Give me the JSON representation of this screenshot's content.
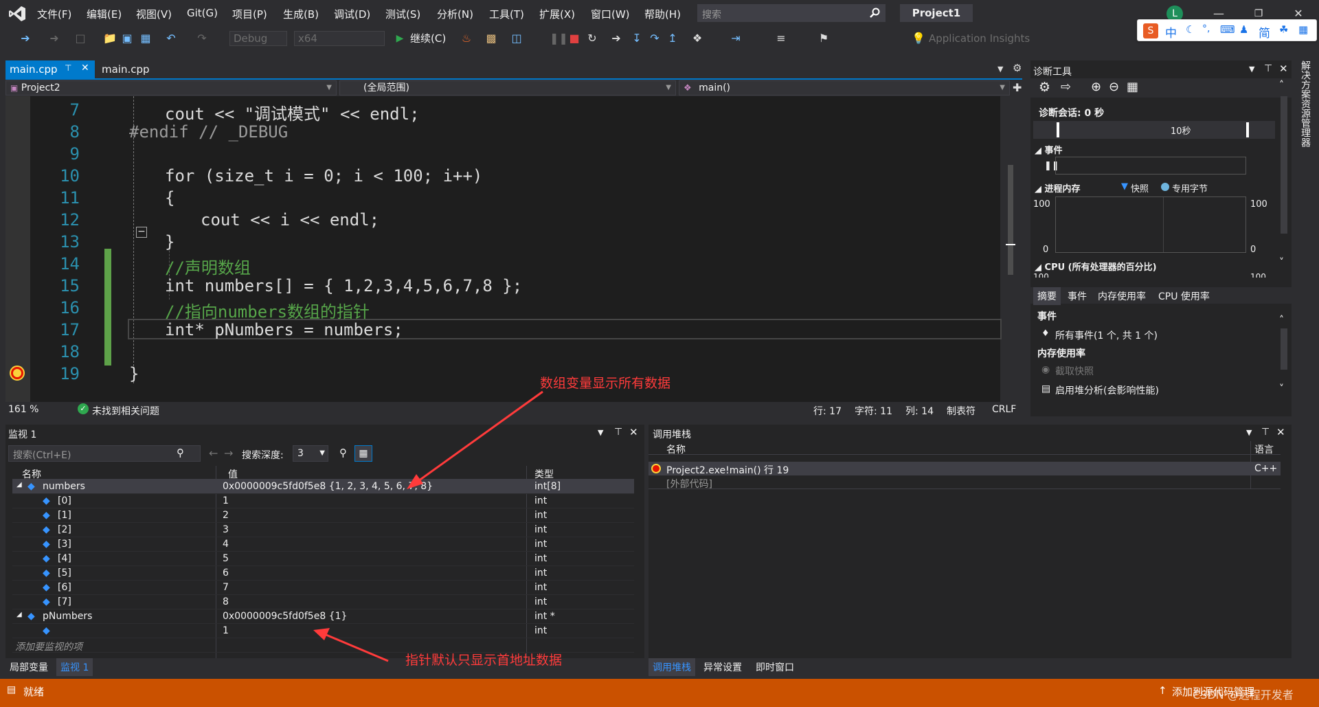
{
  "menu": [
    "文件(F)",
    "编辑(E)",
    "视图(V)",
    "Git(G)",
    "项目(P)",
    "生成(B)",
    "调试(D)",
    "测试(S)",
    "分析(N)",
    "工具(T)",
    "扩展(X)",
    "窗口(W)",
    "帮助(H)"
  ],
  "search": {
    "placeholder": "搜索"
  },
  "project_title": "Project1",
  "avatar_letter": "L",
  "toolbar": {
    "config": "Debug",
    "platform": "x64",
    "continue_label": "继续(C)",
    "insights": "Application Insights"
  },
  "ime": {
    "mode": "中",
    "simplified": "简"
  },
  "tabs": [
    {
      "label": "main.cpp",
      "active": true
    },
    {
      "label": "main.cpp",
      "active": false
    }
  ],
  "nav": {
    "project": "Project2",
    "scope": "(全局范围)",
    "function": "main()"
  },
  "code_lines": [
    {
      "num": "7",
      "text": "cout << \"调试模式\" << endl;"
    },
    {
      "num": "8",
      "text": "#endif // _DEBUG"
    },
    {
      "num": "9",
      "text": ""
    },
    {
      "num": "10",
      "text": "for (size_t i = 0; i < 100; i++)"
    },
    {
      "num": "11",
      "text": "{"
    },
    {
      "num": "12",
      "text": "cout << i << endl;"
    },
    {
      "num": "13",
      "text": "}"
    },
    {
      "num": "14",
      "text": "//声明数组"
    },
    {
      "num": "15",
      "text": "int numbers[] = { 1,2,3,4,5,6,7,8 };"
    },
    {
      "num": "16",
      "text": "//指向numbers数组的指针"
    },
    {
      "num": "17",
      "text": "int* pNumbers = numbers;"
    },
    {
      "num": "18",
      "text": ""
    },
    {
      "num": "19",
      "text": "}"
    }
  ],
  "editor_status": {
    "zoom": "161 %",
    "issues": "未找到相关问题",
    "line": "行: 17",
    "char": "字符: 11",
    "col": "列: 14",
    "tab": "制表符",
    "eol": "CRLF"
  },
  "diag": {
    "title": "诊断工具",
    "session": "诊断会话: 0 秒",
    "timeline_label": "10秒",
    "events_header": "事件",
    "memory_header": "进程内存",
    "legend_snapshot": "快照",
    "legend_private": "专用字节",
    "mem_max": "100",
    "mem_min": "0",
    "cpu_header": "CPU (所有处理器的百分比)",
    "cpu_max": "100",
    "tabs": [
      "摘要",
      "事件",
      "内存使用率",
      "CPU 使用率"
    ],
    "events_section": "事件",
    "all_events": "所有事件(1 个, 共 1 个)",
    "mem_section": "内存使用率",
    "take_snapshot": "截取快照",
    "heap_analysis": "启用堆分析(会影响性能)"
  },
  "side_tab": "解决方案资源管理器",
  "watch": {
    "title": "监视 1",
    "search_placeholder": "搜索(Ctrl+E)",
    "depth_label": "搜索深度:",
    "depth_value": "3",
    "columns": [
      "名称",
      "值",
      "类型"
    ],
    "rows": [
      {
        "name": "numbers",
        "value": "0x0000009c5fd0f5e8 {1, 2, 3, 4, 5, 6, 7, 8}",
        "type": "int[8]"
      },
      {
        "name": "[0]",
        "value": "1",
        "type": "int"
      },
      {
        "name": "[1]",
        "value": "2",
        "type": "int"
      },
      {
        "name": "[2]",
        "value": "3",
        "type": "int"
      },
      {
        "name": "[3]",
        "value": "4",
        "type": "int"
      },
      {
        "name": "[4]",
        "value": "5",
        "type": "int"
      },
      {
        "name": "[5]",
        "value": "6",
        "type": "int"
      },
      {
        "name": "[6]",
        "value": "7",
        "type": "int"
      },
      {
        "name": "[7]",
        "value": "8",
        "type": "int"
      },
      {
        "name": "pNumbers",
        "value": "0x0000009c5fd0f5e8 {1}",
        "type": "int *"
      },
      {
        "name": "",
        "value": "1",
        "type": "int"
      }
    ],
    "add_item": "添加要监视的项",
    "bottom_tabs": [
      "局部变量",
      "监视 1"
    ]
  },
  "callstack": {
    "title": "调用堆栈",
    "columns": [
      "名称",
      "语言"
    ],
    "rows": [
      {
        "name": "Project2.exe!main() 行 19",
        "lang": "C++"
      },
      {
        "name": "[外部代码]",
        "lang": ""
      }
    ],
    "bottom_tabs": [
      "调用堆栈",
      "异常设置",
      "即时窗口"
    ]
  },
  "annotations": {
    "array": "数组变量显示所有数据",
    "pointer": "指针默认只显示首地址数据"
  },
  "status": {
    "ready": "就绪",
    "source_control": "添加到源代码管理",
    "watermark": "CSDN @远程开发者"
  },
  "colors": {
    "accent": "#007acc",
    "status_bar": "#ca5100",
    "annotation": "#ff3b3b"
  }
}
